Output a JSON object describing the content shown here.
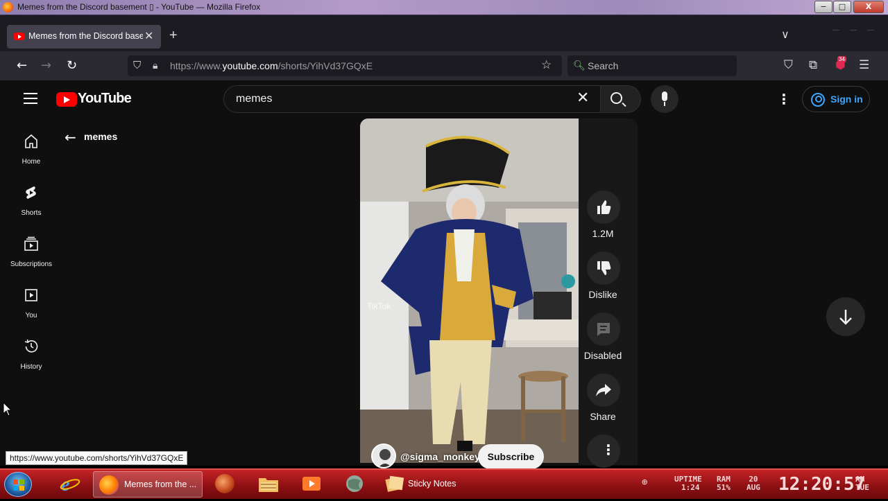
{
  "window": {
    "title": "Memes from the Discord basement ▯ - YouTube — Mozilla Firefox",
    "min": "−",
    "max": "□",
    "close": "X"
  },
  "browser": {
    "tab_title": "Memes from the Discord basem",
    "tab_close": "✕",
    "new_tab": "+",
    "tab_list": "∨",
    "url_prefix": "https://www.",
    "url_domain": "youtube.com",
    "url_path": "/shorts/YihVd37GQxE",
    "search_placeholder": "Search",
    "extension_badge": "34"
  },
  "youtube": {
    "logo_text": "YouTube",
    "search_query": "memes",
    "sign_in": "Sign in",
    "back_label": "memes",
    "sidebar": [
      {
        "id": "home",
        "label": "Home",
        "icon": "home-icon"
      },
      {
        "id": "shorts",
        "label": "Shorts",
        "icon": "shorts-icon"
      },
      {
        "id": "subscriptions",
        "label": "Subscriptions",
        "icon": "subscriptions-icon"
      },
      {
        "id": "you",
        "label": "You",
        "icon": "you-icon"
      },
      {
        "id": "history",
        "label": "History",
        "icon": "history-icon"
      }
    ],
    "short": {
      "likes": "1.2M",
      "dislike_label": "Dislike",
      "comments_label": "Disabled",
      "share_label": "Share",
      "channel": "@sigma_monkey",
      "subscribe": "Subscribe",
      "watermark": "TikTok"
    }
  },
  "status_url": "https://www.youtube.com/shorts/YihVd37GQxE",
  "taskbar": {
    "firefox_label": "Memes from the ...",
    "sticky_label": "Sticky Notes",
    "uptime_label": "UPTIME",
    "uptime_value": "1:24",
    "ram_label": "RAM",
    "ram_value": "51%",
    "date_day": "20",
    "date_month": "AUG",
    "clock": "12:20:57",
    "ampm": "AM",
    "weekday": "TUE"
  },
  "colors": {
    "youtube_red": "#ff0000",
    "sign_in_blue": "#3ea6ff",
    "taskbar_red": "#b01a1d"
  }
}
